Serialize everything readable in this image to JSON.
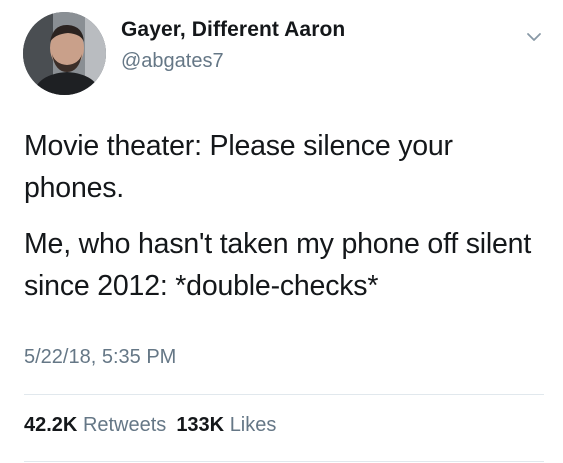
{
  "user": {
    "display_name": "Gayer, Different Aaron",
    "handle": "@abgates7",
    "avatar_icon": "profile-photo"
  },
  "tweet": {
    "paragraphs": [
      "Movie theater: Please silence your phones.",
      "Me, who hasn't taken my phone off silent since 2012: *double-checks*"
    ],
    "timestamp": "5/22/18, 5:35 PM"
  },
  "stats": {
    "retweets_count": "42.2K",
    "retweets_label": "Retweets",
    "likes_count": "133K",
    "likes_label": "Likes"
  },
  "colors": {
    "text": "#14171a",
    "secondary": "#657786",
    "divider": "#e1e8ed"
  },
  "icons": {
    "menu": "chevron-down-icon"
  }
}
